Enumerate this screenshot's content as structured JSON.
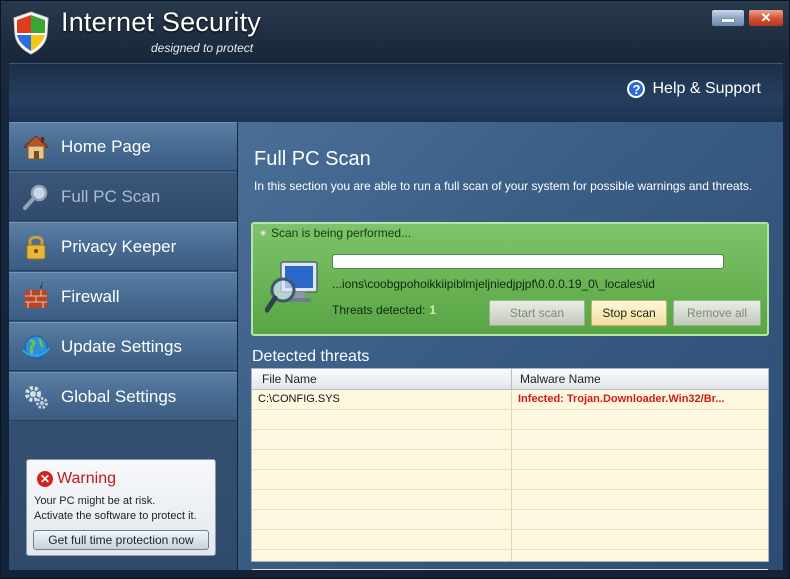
{
  "app": {
    "title": "Internet Security",
    "subtitle": "designed to protect"
  },
  "header": {
    "help_label": "Help & Support"
  },
  "sidebar": {
    "items": [
      {
        "label": "Home Page",
        "icon": "house-icon"
      },
      {
        "label": "Full PC Scan",
        "icon": "magnifier-icon",
        "active": true
      },
      {
        "label": "Privacy Keeper",
        "icon": "padlock-icon"
      },
      {
        "label": "Firewall",
        "icon": "brick-wall-icon"
      },
      {
        "label": "Update Settings",
        "icon": "globe-icon"
      },
      {
        "label": "Global Settings",
        "icon": "gears-icon"
      }
    ],
    "warning": {
      "title": "Warning",
      "line1": "Your PC might be at risk.",
      "line2": "Activate the software to protect it.",
      "button": "Get full time protection now"
    }
  },
  "main": {
    "title": "Full PC Scan",
    "description": "In this section you are able to run a full scan of your system for possible warnings and threats.",
    "scan": {
      "status": "Scan is being performed...",
      "progress": 0.0,
      "current_path": "...ions\\coobgpohoikkiipiblmjeljniedjpjpf\\0.0.0.19_0\\_locales\\id",
      "threats_label": "Threats detected:",
      "threats_count": "1",
      "start_label": "Start scan",
      "stop_label": "Stop scan",
      "remove_label": "Remove all"
    },
    "detected": {
      "title": "Detected threats",
      "columns": [
        "File Name",
        "Malware Name"
      ],
      "rows": [
        {
          "file": "C:\\CONFIG.SYS",
          "malware": "Infected: Trojan.Downloader.Win32/Br..."
        }
      ]
    }
  },
  "colors": {
    "accent": "#58a544",
    "danger": "#d21a1a"
  }
}
